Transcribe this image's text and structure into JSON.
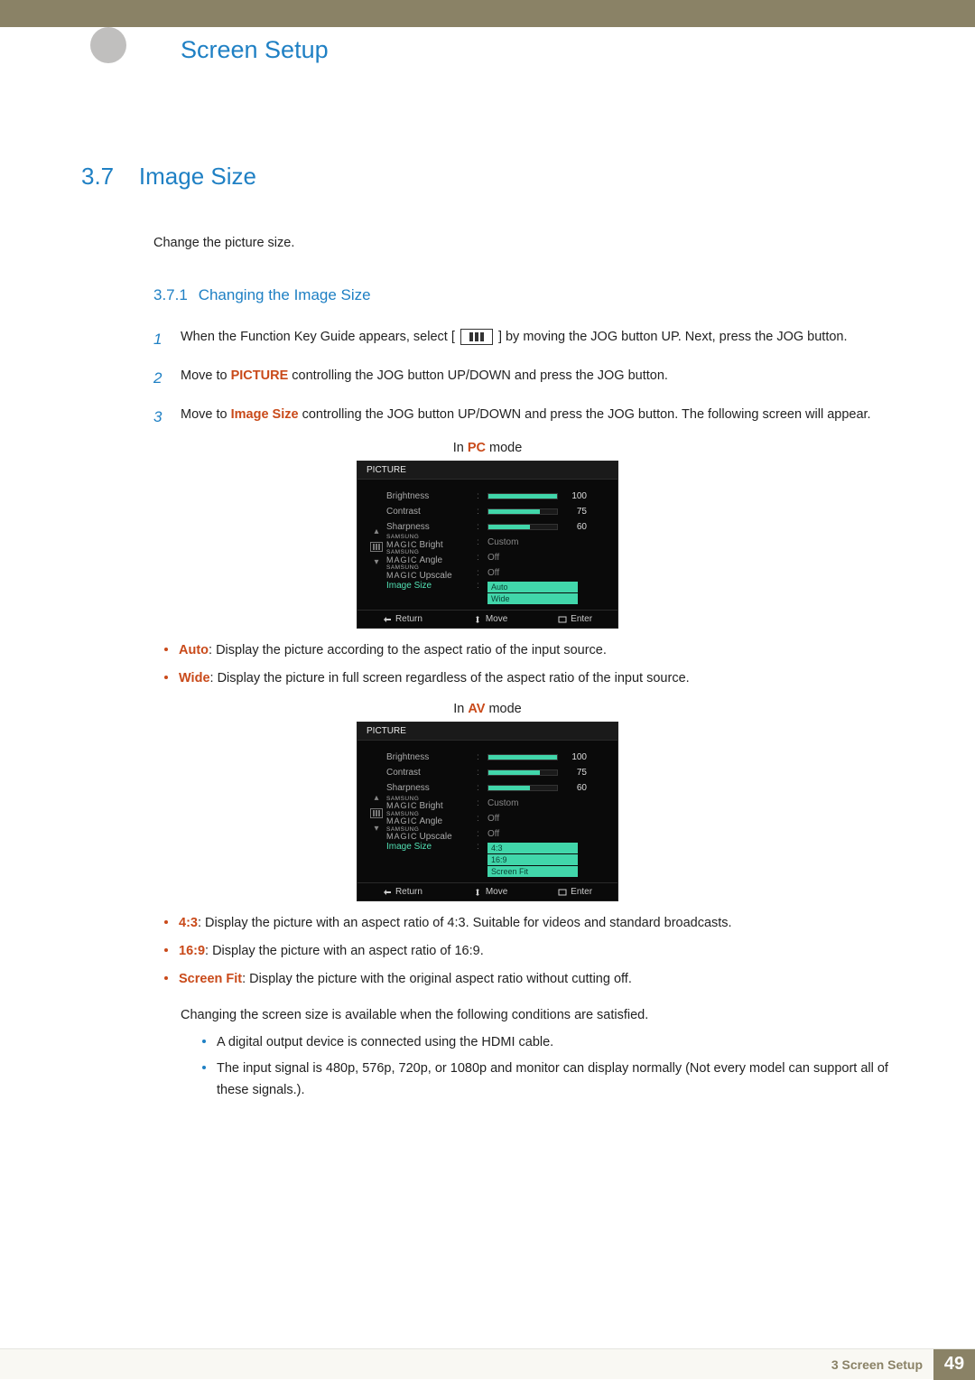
{
  "header": {
    "page_title": "Screen Setup"
  },
  "section": {
    "number": "3.7",
    "title": "Image Size",
    "intro": "Change the picture size."
  },
  "subsection": {
    "number": "3.7.1",
    "title": "Changing the Image Size"
  },
  "steps": {
    "s1": {
      "num": "1",
      "pre": "When the Function Key Guide appears, select [",
      "post": "] by moving the JOG button UP. Next, press the JOG button."
    },
    "s2": {
      "num": "2",
      "pre": "Move to ",
      "bold": "PICTURE",
      "post": " controlling the JOG button UP/DOWN and press the JOG button."
    },
    "s3": {
      "num": "3",
      "pre": "Move to ",
      "bold": "Image Size",
      "post": " controlling the JOG button UP/DOWN and press the JOG button. The following screen will appear."
    }
  },
  "mode_labels": {
    "pc_pre": "In ",
    "pc_bold": "PC",
    "pc_post": " mode",
    "av_pre": "In ",
    "av_bold": "AV",
    "av_post": " mode"
  },
  "osd": {
    "title": "PICTURE",
    "rows": {
      "brightness": {
        "label": "Brightness",
        "value": 100
      },
      "contrast": {
        "label": "Contrast",
        "value": 75
      },
      "sharpness": {
        "label": "Sharpness",
        "value": 60
      },
      "bright": {
        "suffix": "Bright",
        "value": "Custom"
      },
      "angle": {
        "suffix": "Angle",
        "value": "Off"
      },
      "upscale": {
        "suffix": "Upscale",
        "value": "Off"
      },
      "image_size": {
        "label": "Image Size"
      }
    },
    "magic_brand_top": "SAMSUNG",
    "magic_brand_bot": "MAGIC",
    "options_pc": {
      "o1": "Auto",
      "o2": "Wide"
    },
    "options_av": {
      "o1": "4:3",
      "o2": "16:9",
      "o3": "Screen Fit"
    },
    "footer": {
      "return": "Return",
      "move": "Move",
      "enter": "Enter"
    }
  },
  "bullets_pc": {
    "b1": {
      "bold": "Auto",
      "text": ": Display the picture according to the aspect ratio of the input source."
    },
    "b2": {
      "bold": "Wide",
      "text": ": Display the picture in full screen regardless of the aspect ratio of the input source."
    }
  },
  "bullets_av": {
    "b1": {
      "bold": "4:3",
      "text": ": Display the picture with an aspect ratio of 4:3. Suitable for videos and standard broadcasts."
    },
    "b2": {
      "bold": "16:9",
      "text": ": Display the picture with an aspect ratio of 16:9."
    },
    "b3": {
      "bold": "Screen Fit",
      "text": ": Display the picture with the original aspect ratio without cutting off."
    }
  },
  "note": {
    "lead": "Changing the screen size is available when the following conditions are satisfied.",
    "c1": "A digital output device is connected using the HDMI cable.",
    "c2": "The input signal is 480p, 576p, 720p, or 1080p and monitor can display normally (Not every model can support all of these signals.)."
  },
  "footer": {
    "chapter": "3 Screen Setup",
    "page": "49"
  },
  "chart_data": {
    "type": "bar",
    "title": "PICTURE OSD slider values",
    "categories": [
      "Brightness",
      "Contrast",
      "Sharpness"
    ],
    "values": [
      100,
      75,
      60
    ],
    "ylim": [
      0,
      100
    ],
    "xlabel": "",
    "ylabel": ""
  }
}
